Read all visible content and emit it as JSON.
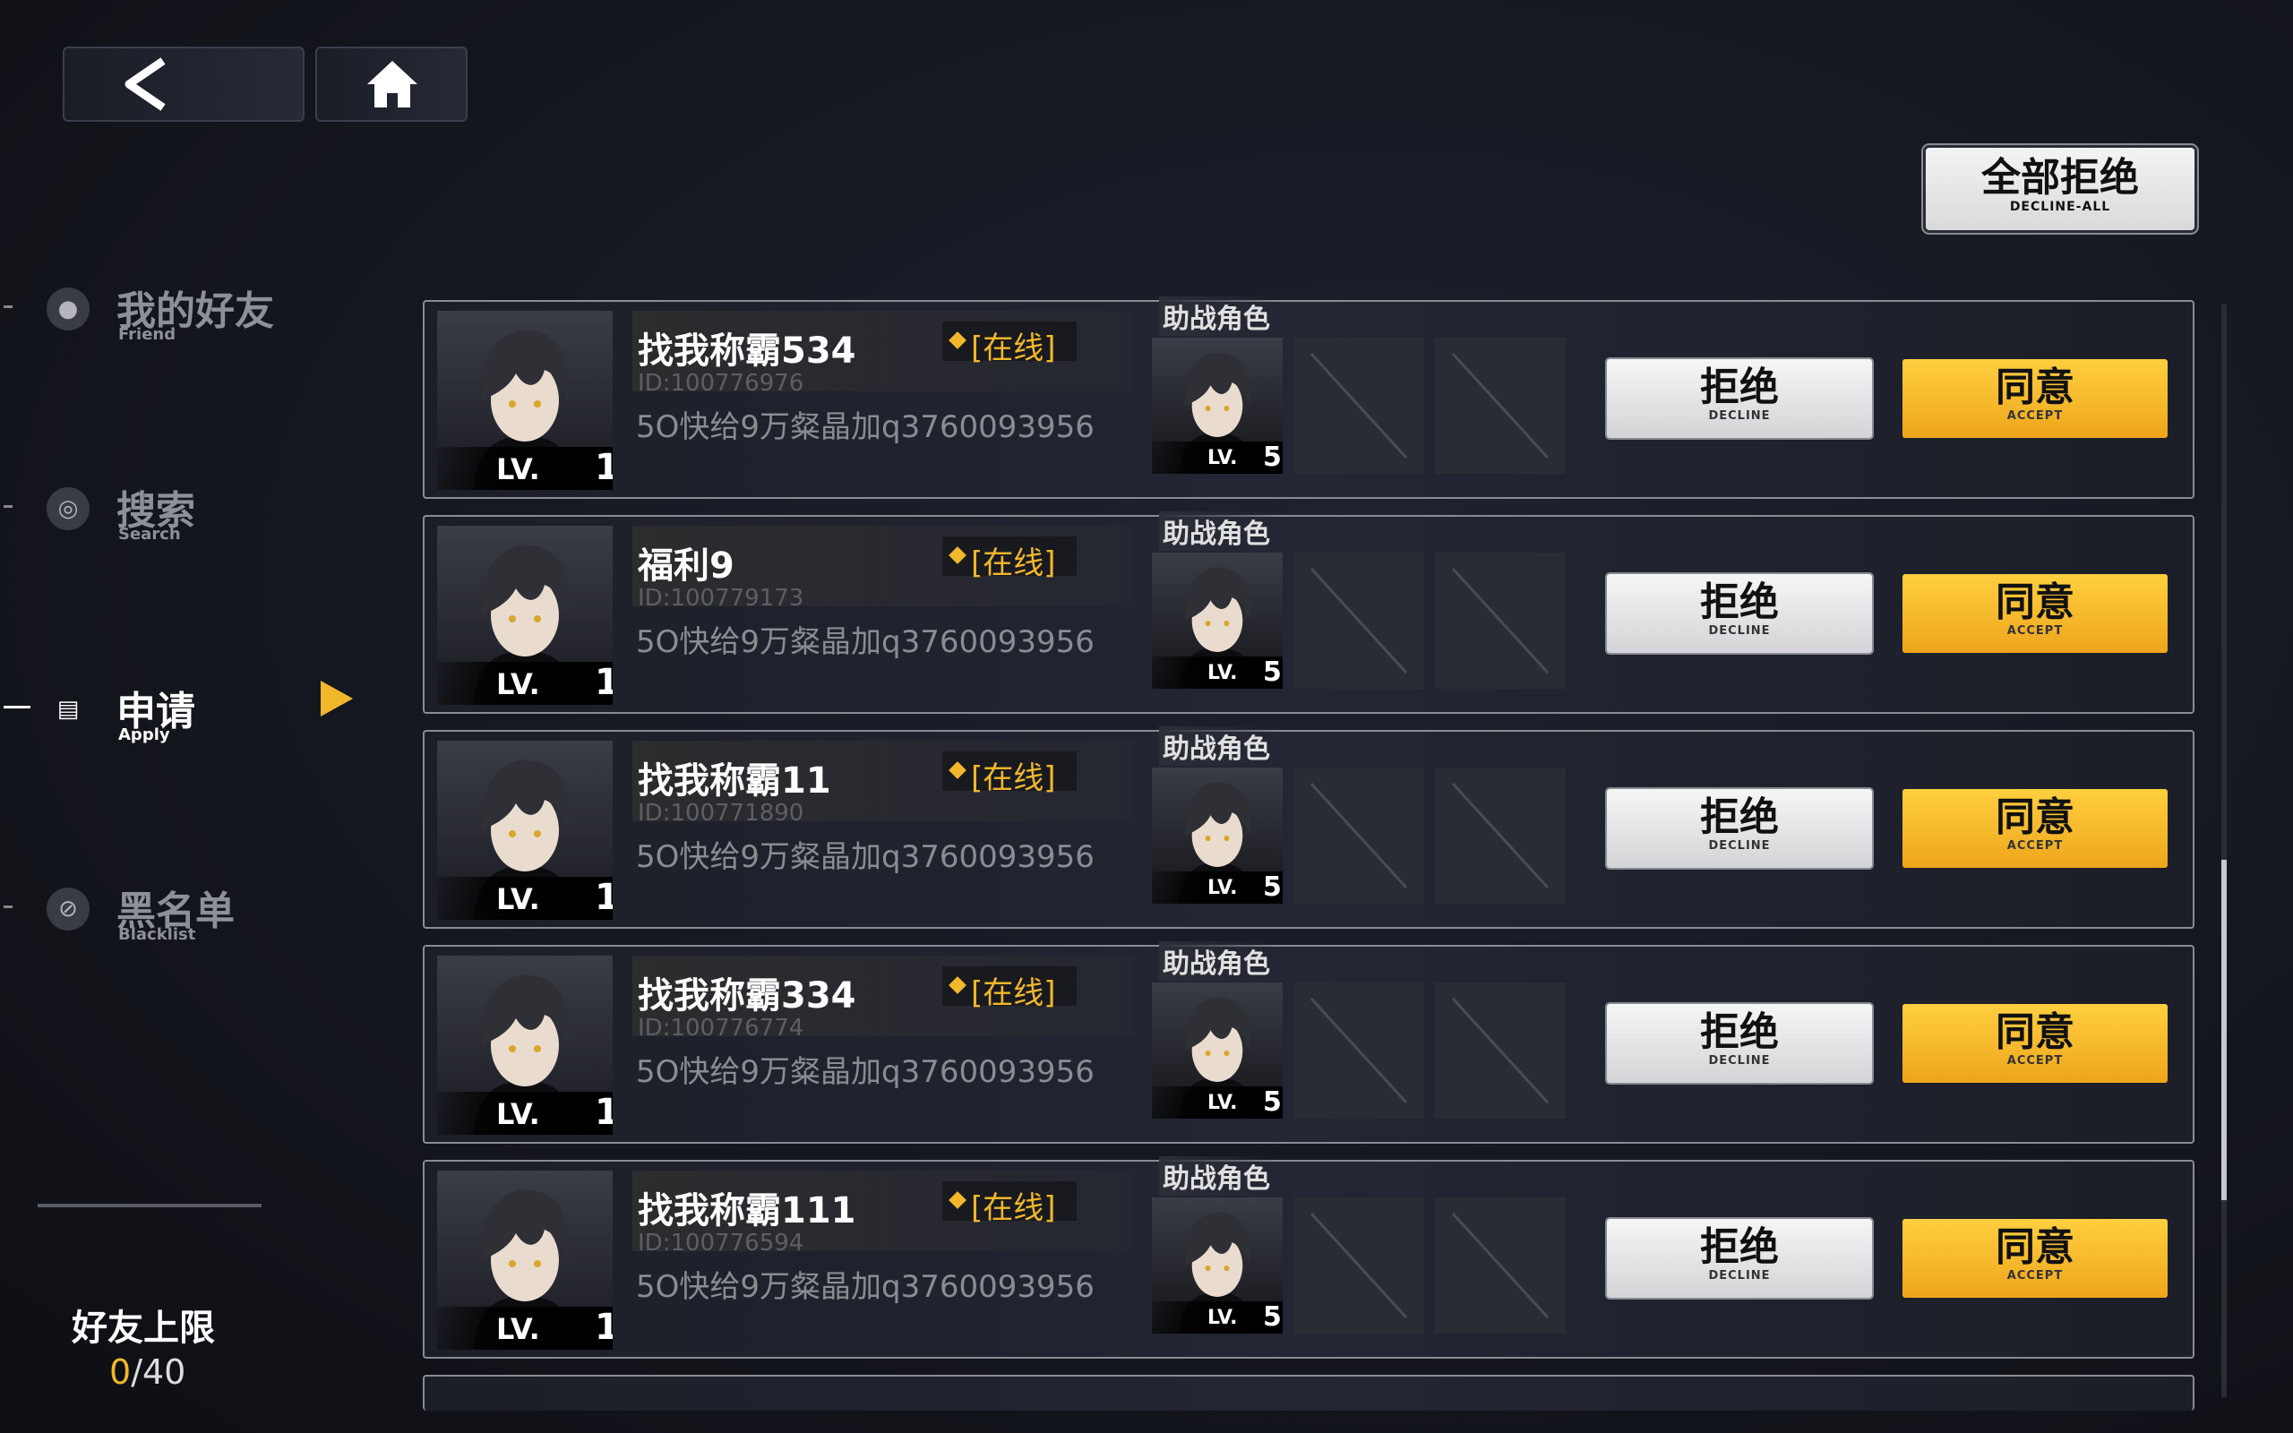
{
  "nav": {
    "back_icon": "back-arrow-icon",
    "home_icon": "home-icon"
  },
  "decline_all": {
    "label": "全部拒绝",
    "sublabel": "DECLINE-ALL"
  },
  "sidebar": {
    "items": [
      {
        "zh": "我的好友",
        "en": "Friend",
        "icon": "person-icon",
        "active": false
      },
      {
        "zh": "搜索",
        "en": "Search",
        "icon": "search-icon",
        "active": false
      },
      {
        "zh": "申请",
        "en": "Apply",
        "icon": "document-icon",
        "active": true
      },
      {
        "zh": "黑名单",
        "en": "Blacklist",
        "icon": "block-icon",
        "active": false
      }
    ],
    "limit_label": "好友上限",
    "limit_current": "0",
    "limit_max": "/40"
  },
  "common": {
    "status": "[在线]",
    "assist_label": "助战角色",
    "lv_text": "LV.",
    "decline_label": "拒绝",
    "decline_sub": "DECLINE",
    "accept_label": "同意",
    "accept_sub": "ACCEPT"
  },
  "requests": [
    {
      "name": "找我称霸534",
      "id": "ID:100776976",
      "message": "5O快给9万粲晶加q3760093956",
      "level": "1",
      "assist_level": "5"
    },
    {
      "name": "福利9",
      "id": "ID:100779173",
      "message": "5O快给9万粲晶加q3760093956",
      "level": "1",
      "assist_level": "5"
    },
    {
      "name": "找我称霸11",
      "id": "ID:100771890",
      "message": "5O快给9万粲晶加q3760093956",
      "level": "1",
      "assist_level": "5"
    },
    {
      "name": "找我称霸334",
      "id": "ID:100776774",
      "message": "5O快给9万粲晶加q3760093956",
      "level": "1",
      "assist_level": "5"
    },
    {
      "name": "找我称霸111",
      "id": "ID:100776594",
      "message": "5O快给9万粲晶加q3760093956",
      "level": "1",
      "assist_level": "5"
    }
  ],
  "colors": {
    "accent": "#f2b72b",
    "card_border": "#8a8c94"
  }
}
